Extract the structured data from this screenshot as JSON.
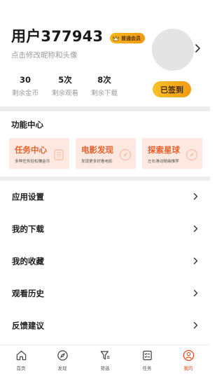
{
  "profile": {
    "username": "用户377943",
    "vip_badge": "普通会员",
    "subtitle": "点击修改昵称和头像",
    "stats": [
      {
        "value": "30",
        "label": "剩余金币"
      },
      {
        "value": "5次",
        "label": "剩余观看"
      },
      {
        "value": "8次",
        "label": "剩余下载"
      }
    ],
    "checkin_label": "已签到"
  },
  "features": {
    "title": "功能中心",
    "cards": [
      {
        "title": "任务中心",
        "subtitle": "多种任务轻松赚金币",
        "icon": "document-icon"
      },
      {
        "title": "电影发现",
        "subtitle": "发现更多好看电影",
        "icon": "compass-icon"
      },
      {
        "title": "探索星球",
        "subtitle": "左右滑动随缘推荐",
        "icon": "compass-icon"
      }
    ]
  },
  "menu": [
    {
      "label": "应用设置"
    },
    {
      "label": "我的下载"
    },
    {
      "label": "我的收藏"
    },
    {
      "label": "观看历史"
    },
    {
      "label": "反馈建议"
    }
  ],
  "bottom_nav": [
    {
      "label": "首页",
      "icon": "home-icon"
    },
    {
      "label": "发现",
      "icon": "compass-icon"
    },
    {
      "label": "筛选",
      "icon": "filter-icon"
    },
    {
      "label": "任务",
      "icon": "task-icon"
    },
    {
      "label": "我的",
      "icon": "user-icon",
      "active": true
    }
  ],
  "colors": {
    "accent": "#e8622a",
    "active_nav": "#e4481e",
    "badge_gold": "#f6b51d",
    "card_bg": "#fde9e2"
  }
}
